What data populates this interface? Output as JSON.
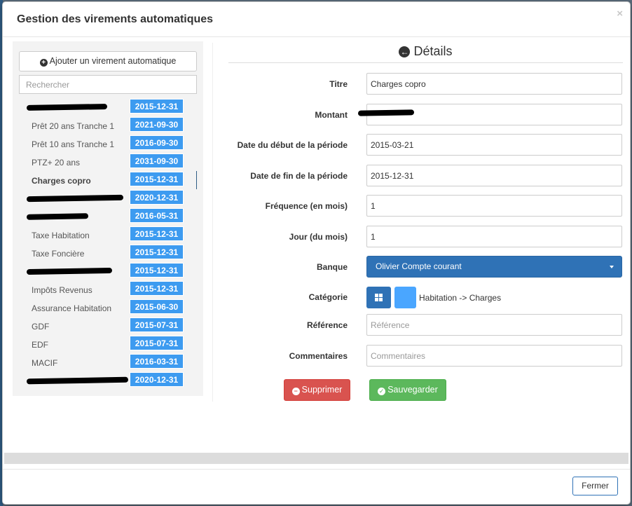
{
  "modal": {
    "title": "Gestion des virements automatiques",
    "close_glyph": "×"
  },
  "sidebar": {
    "add_button_label": "Ajouter un virement automatique",
    "search_placeholder": "Rechercher",
    "items": [
      {
        "name": "",
        "date": "2015-12-31",
        "redacted": true
      },
      {
        "name": "Prêt 20 ans Tranche 1",
        "date": "2021-09-30"
      },
      {
        "name": "Prêt 10 ans Tranche 1",
        "date": "2016-09-30"
      },
      {
        "name": "PTZ+ 20 ans",
        "date": "2031-09-30"
      },
      {
        "name": "Charges copro",
        "date": "2015-12-31",
        "active": true
      },
      {
        "name": "",
        "date": "2020-12-31",
        "redacted": true
      },
      {
        "name": "",
        "date": "2016-05-31",
        "redacted": true
      },
      {
        "name": "Taxe Habitation",
        "date": "2015-12-31"
      },
      {
        "name": "Taxe Foncière",
        "date": "2015-12-31"
      },
      {
        "name": "",
        "date": "2015-12-31",
        "redacted": true
      },
      {
        "name": "Impôts Revenus",
        "date": "2015-12-31"
      },
      {
        "name": "Assurance Habitation",
        "date": "2015-06-30"
      },
      {
        "name": "GDF",
        "date": "2015-07-31"
      },
      {
        "name": "EDF",
        "date": "2015-07-31"
      },
      {
        "name": "MACIF",
        "date": "2016-03-31"
      },
      {
        "name": "",
        "date": "2020-12-31",
        "redacted": true
      }
    ]
  },
  "details": {
    "title": "Détails",
    "fields": {
      "titre": {
        "label": "Titre",
        "value": "Charges copro"
      },
      "montant": {
        "label": "Montant",
        "value": ""
      },
      "date_debut": {
        "label": "Date du début de la période",
        "value": "2015-03-21"
      },
      "date_fin": {
        "label": "Date de fin de la période",
        "value": "2015-12-31"
      },
      "frequence": {
        "label": "Fréquence (en mois)",
        "value": "1"
      },
      "jour": {
        "label": "Jour (du mois)",
        "value": "1"
      },
      "banque": {
        "label": "Banque",
        "value": "Olivier Compte courant"
      },
      "categorie": {
        "label": "Catégorie",
        "value": "Habitation -> Charges",
        "color": "#4aa6ff"
      },
      "reference": {
        "label": "Référence",
        "placeholder": "Référence"
      },
      "commentaires": {
        "label": "Commentaires",
        "placeholder": "Commentaires"
      }
    },
    "delete_label": "Supprimer",
    "save_label": "Sauvegarder"
  },
  "footer": {
    "close_label": "Fermer"
  },
  "colors": {
    "primary": "#2f72b6",
    "date_badge": "#3d9bf0",
    "danger": "#d9534f",
    "success": "#5cb85c"
  }
}
